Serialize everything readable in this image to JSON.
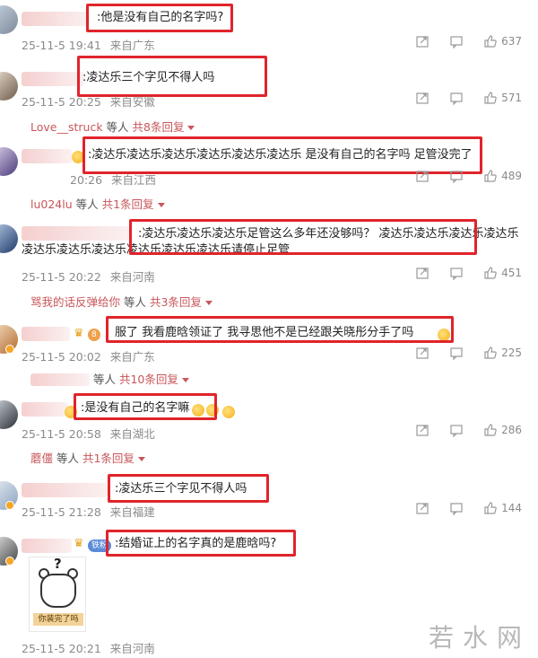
{
  "comments": [
    {
      "text": ":他是没有自己的名字吗?",
      "date": "25-11-5 19:41",
      "location": "来自广东",
      "likes": "637"
    },
    {
      "text": ":凌达乐三个字见不得人吗",
      "date": "25-11-5 20:25",
      "location": "来自安徽",
      "likes": "571",
      "reply": {
        "who": "Love__struck",
        "suffix": " 等人 ",
        "more": "共8条回复"
      }
    },
    {
      "text": ":凌达乐凌达乐凌达乐凌达乐凌达乐凌达乐 是没有自己的名字吗 足管没完了",
      "date": "20:26",
      "location": "来自江西",
      "likes": "489",
      "reply": {
        "who": "lu024lu",
        "suffix": " 等人 ",
        "more": "共1条回复"
      }
    },
    {
      "text": ":凌达乐凌达乐凌达乐足管这么多年还没够吗？ 凌达乐凌达乐凌达乐凌达乐凌达乐凌达乐凌达乐凌达乐凌达乐凌达乐请停止足管",
      "date": "25-11-5 20:22",
      "location": "来自河南",
      "likes": "451",
      "reply": {
        "who": "骂我的话反弹给你",
        "suffix": " 等人 ",
        "more": "共3条回复"
      }
    },
    {
      "text": "服了 我看鹿晗领证了 我寻思他不是已经跟关晓彤分手了吗",
      "badge": "8",
      "date": "25-11-5 20:02",
      "location": "来自广东",
      "likes": "225",
      "reply": {
        "who": "",
        "suffix": "等人 ",
        "more": "共10条回复"
      }
    },
    {
      "text": ":是没有自己的名字嘛",
      "date": "25-11-5 20:58",
      "location": "来自湖北",
      "likes": "286",
      "reply": {
        "who": "蘑僵",
        "suffix": " 等人 ",
        "more": "共1条回复"
      }
    },
    {
      "text": ":凌达乐三个字见不得人吗",
      "date": "25-11-5 21:28",
      "location": "来自福建",
      "likes": "144"
    },
    {
      "text": ":结婚证上的名字真的是鹿晗吗?",
      "badge": "铁粉",
      "date": "25-11-5 20:21",
      "location": "来自河南",
      "sticker_caption": "你装完了吗"
    }
  ],
  "watermark": "若水网",
  "icons": [
    "share-icon",
    "comment-icon",
    "like-icon"
  ],
  "colors": {
    "highlight": "#e0242b",
    "reply_link": "#c8565a",
    "meta": "#8a8a8a"
  }
}
